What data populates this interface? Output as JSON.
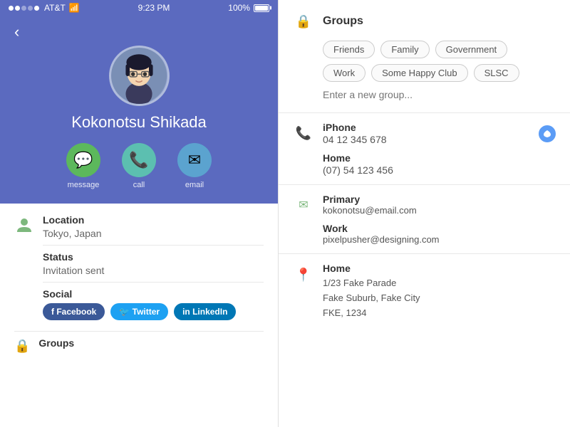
{
  "statusBar": {
    "carrier": "AT&T",
    "time": "9:23 PM",
    "signal": "●●●○○",
    "battery": "100%"
  },
  "profile": {
    "name": "Kokonotsu Shikada",
    "actions": {
      "message": "message",
      "call": "call",
      "email": "email"
    }
  },
  "leftInfo": {
    "locationLabel": "Location",
    "locationValue": "Tokyo, Japan",
    "statusLabel": "Status",
    "statusValue": "Invitation sent",
    "socialLabel": "Social",
    "socialButtons": [
      {
        "label": "f  Facebook",
        "type": "facebook"
      },
      {
        "label": "🐦 Twitter",
        "type": "twitter"
      },
      {
        "label": "in  LinkedIn",
        "type": "linkedin"
      }
    ],
    "groupsLabel": "Groups"
  },
  "rightPanel": {
    "groupsTitle": "Groups",
    "groups": [
      "Friends",
      "Family",
      "Government",
      "Work",
      "Some Happy Club",
      "SLSC"
    ],
    "newGroupPlaceholder": "Enter a new group...",
    "phoneTitle": "iPhone",
    "phoneNumber": "04 12 345 678",
    "homePhoneType": "Home",
    "homePhoneNumber": "(07) 54 123 456",
    "emailTitle": "Primary",
    "emailValue": "kokonotsu@email.com",
    "workEmailType": "Work",
    "workEmailValue": "pixelpusher@designing.com",
    "addressTitle": "Home",
    "addressLines": [
      "1/23 Fake Parade",
      "Fake Suburb, Fake City",
      "FKE, 1234"
    ]
  }
}
